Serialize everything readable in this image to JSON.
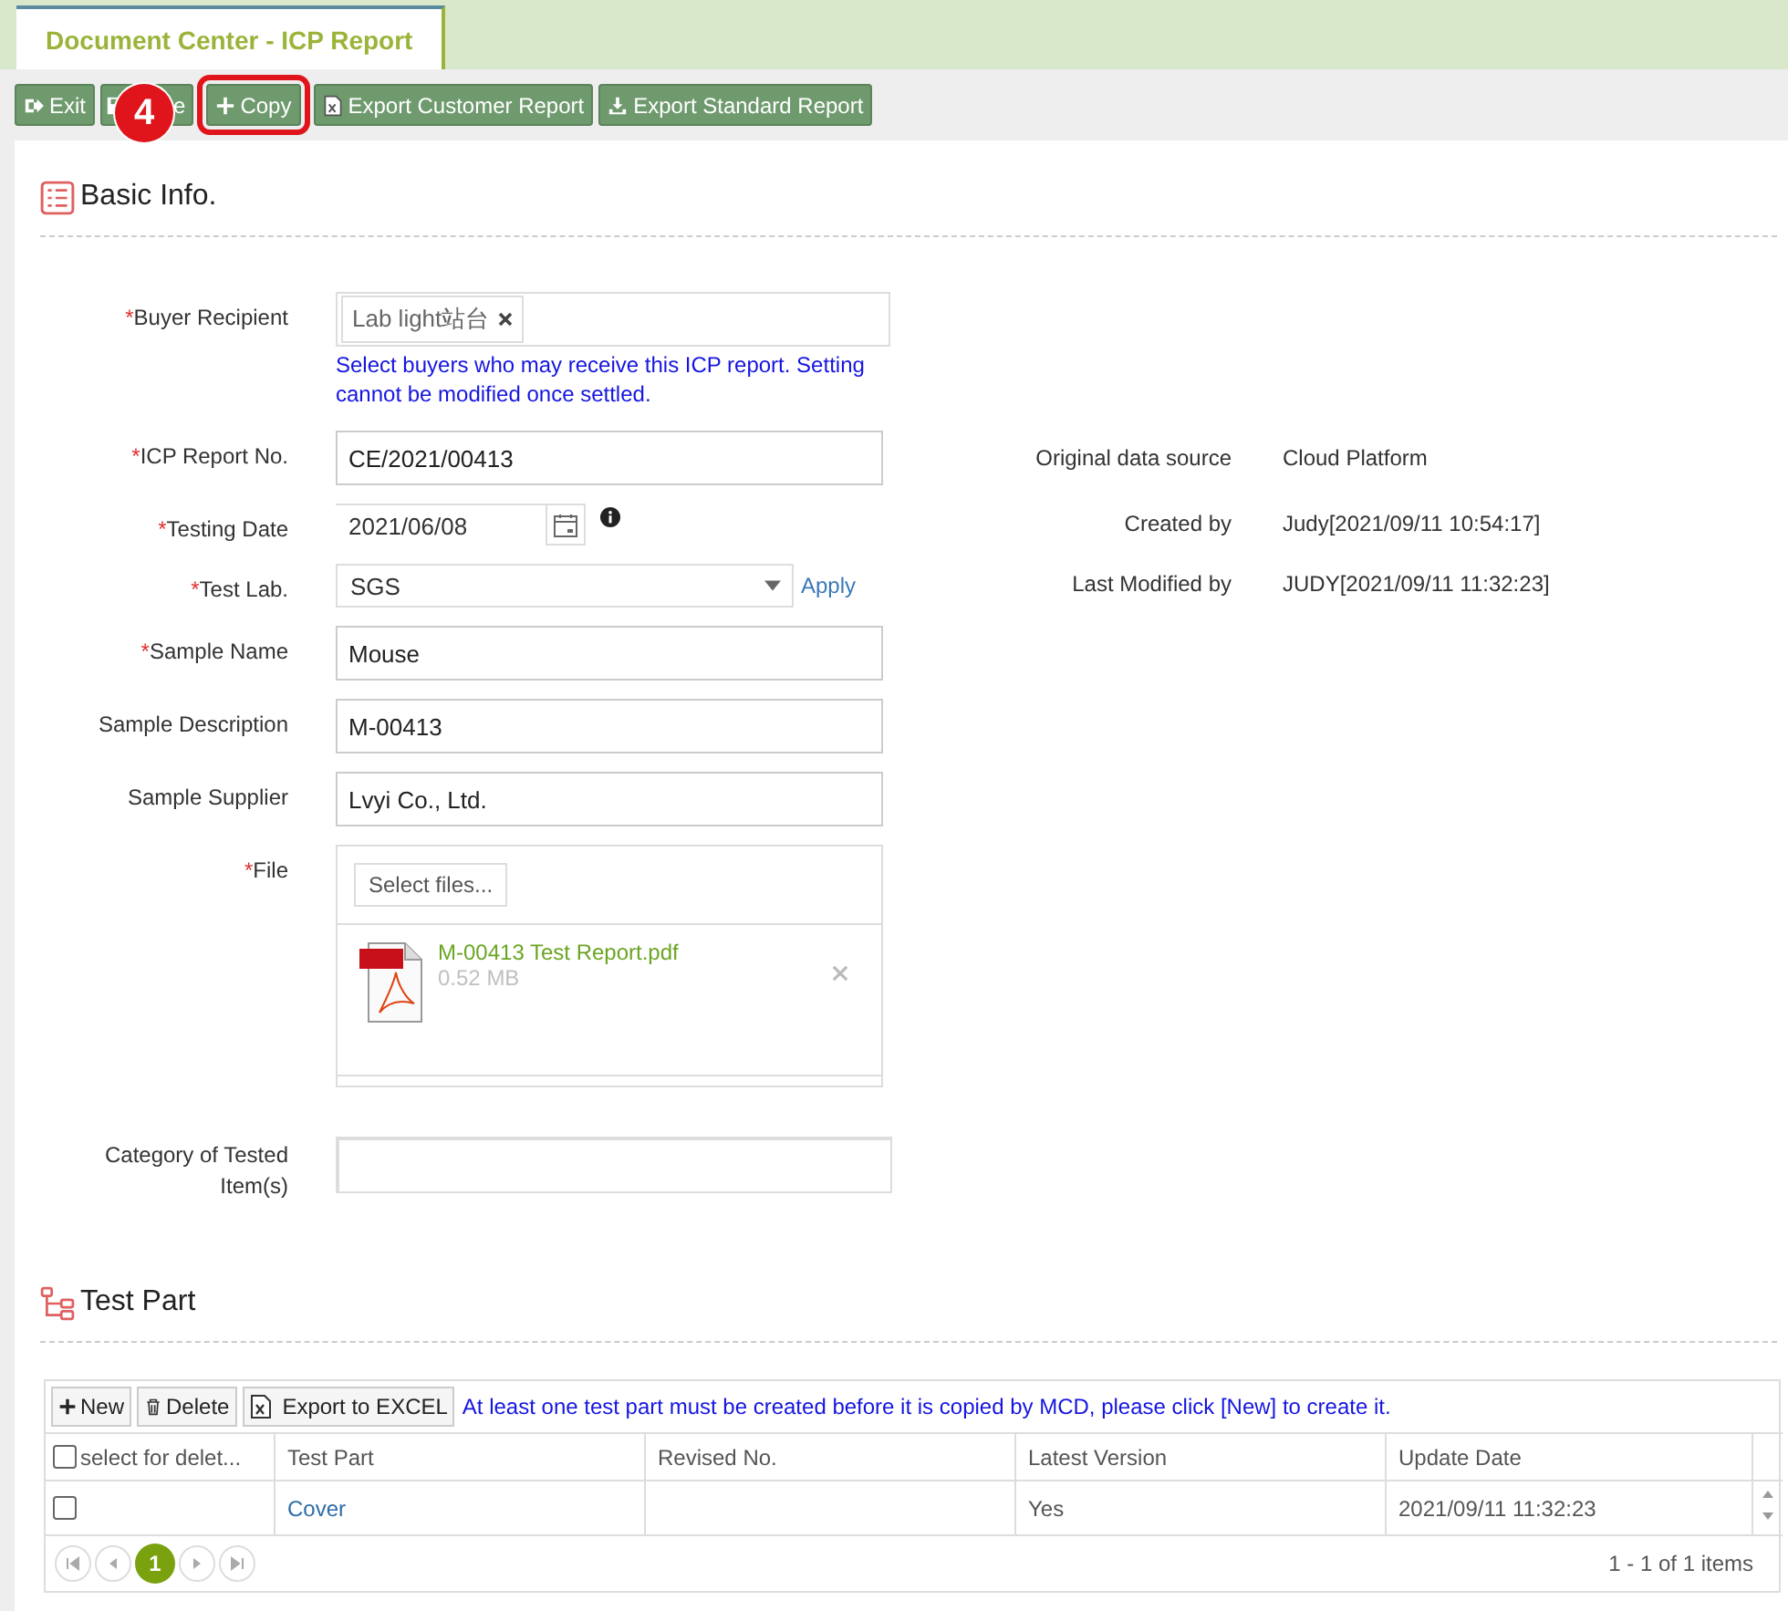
{
  "tab": {
    "label": "Document Center - ICP Report",
    "selected": true
  },
  "toolbar": [
    {
      "kind": "exit",
      "label": "Exit"
    },
    {
      "kind": "save",
      "label": "e"
    },
    {
      "kind": "add",
      "label": "Copy",
      "highlighted": true
    },
    {
      "kind": "excel",
      "label": "Export Customer Report"
    },
    {
      "kind": "download",
      "label": "Export Standard Report"
    }
  ],
  "step_badge": "4",
  "basic_info": {
    "title": "Basic Info.",
    "fields": [
      {
        "kind": "tags",
        "label": "Buyer Recipient",
        "marker": "*",
        "tags": [
          "Lab light站台"
        ],
        "hint": "Select buyers who may receive this ICP report. Setting cannot be modified once settled."
      },
      {
        "kind": "text",
        "label": "ICP Report No.",
        "marker": "*",
        "value": "CE/2021/00413"
      },
      {
        "kind": "date",
        "label": "Testing Date",
        "marker": "*",
        "value": "2021/06/08"
      },
      {
        "kind": "select",
        "label": "Test Lab.",
        "marker": "*",
        "value": "SGS",
        "action": "Apply"
      },
      {
        "kind": "text",
        "label": "Sample Name",
        "marker": "*",
        "value": "Mouse"
      },
      {
        "kind": "text",
        "label": "Sample Description",
        "value": "M-00413"
      },
      {
        "kind": "text",
        "label": "Sample Supplier",
        "value": "Lvyi Co., Ltd."
      },
      {
        "kind": "file",
        "label": "File",
        "marker": "*",
        "button": "Select files...",
        "files": [
          {
            "name": "M-00413 Test Report.pdf",
            "size": "0.52 MB"
          }
        ]
      },
      {
        "kind": "tags",
        "label": "Category of Tested Item(s)"
      }
    ],
    "meta": [
      {
        "label": "Original data source",
        "value": "Cloud Platform"
      },
      {
        "label": "Created by",
        "value": "Judy[2021/09/11 10:54:17]"
      },
      {
        "label": "Last Modified by",
        "value": "JUDY[2021/09/11 11:32:23]"
      }
    ]
  },
  "test_part": {
    "title": "Test Part",
    "buttons": [
      {
        "kind": "add",
        "label": "New"
      },
      {
        "kind": "delete",
        "label": "Delete"
      },
      {
        "kind": "excel",
        "label": "Export to EXCEL"
      }
    ],
    "notice": "At least one test part must be created before it is copied by MCD, please click [New] to create it.",
    "header_checked": false,
    "columns": [
      "select for delet...",
      "Test Part",
      "Revised No.",
      "Latest Version",
      "Update Date"
    ],
    "rows": [
      {
        "checked": false,
        "cells": [
          "",
          "Cover",
          "",
          "Yes",
          "2021/09/11 11:32:23"
        ]
      }
    ],
    "pages": [
      {
        "label": "1",
        "selected": true
      }
    ],
    "summary": "1 - 1 of 1 items"
  }
}
